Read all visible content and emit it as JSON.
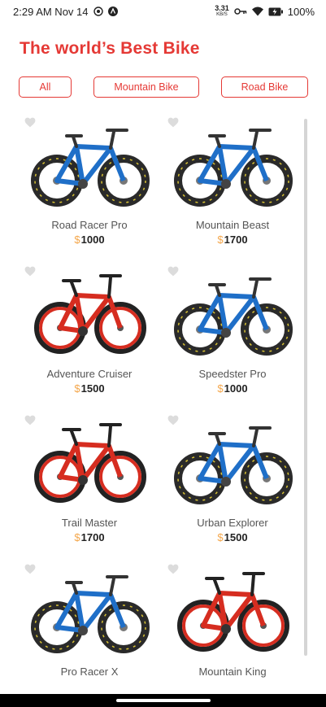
{
  "status_bar": {
    "time": "2:29 AM Nov 14",
    "net_speed_value": "3.31",
    "net_speed_unit": "KB/S",
    "battery_percent": "100%"
  },
  "page": {
    "title": "The world’s Best Bike"
  },
  "filters": {
    "all": "All",
    "mountain": "Mountain Bike",
    "road": "Road Bike"
  },
  "colors": {
    "accent": "#e53935",
    "currency": "#f4a64a",
    "blue_bike": "#1f6fc8",
    "red_bike": "#d62d20"
  },
  "products": [
    {
      "name": "Road Racer Pro",
      "currency": "$",
      "price": "1000",
      "bike_color": "blue"
    },
    {
      "name": "Mountain Beast",
      "currency": "$",
      "price": "1700",
      "bike_color": "blue"
    },
    {
      "name": "Adventure Cruiser",
      "currency": "$",
      "price": "1500",
      "bike_color": "red"
    },
    {
      "name": "Speedster Pro",
      "currency": "$",
      "price": "1000",
      "bike_color": "blue"
    },
    {
      "name": "Trail Master",
      "currency": "$",
      "price": "1700",
      "bike_color": "red"
    },
    {
      "name": "Urban Explorer",
      "currency": "$",
      "price": "1500",
      "bike_color": "blue"
    },
    {
      "name": "Pro Racer X",
      "bike_color": "blue"
    },
    {
      "name": "Mountain King",
      "bike_color": "red"
    }
  ]
}
